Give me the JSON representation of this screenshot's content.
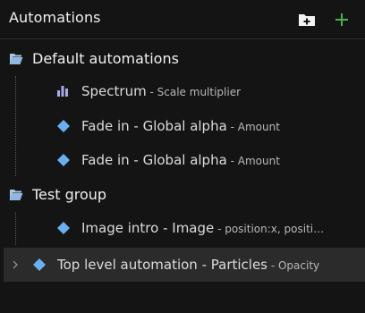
{
  "header": {
    "title": "Automations",
    "add_folder_icon": "folder-plus-icon",
    "add_icon": "plus-icon"
  },
  "groups": [
    {
      "label": "Default automations",
      "icon": "folder-open-icon",
      "items": [
        {
          "main": "Spectrum",
          "sep": " - ",
          "sub": "Scale multiplier",
          "icon": "bar-chart-icon"
        },
        {
          "main": "Fade in - Global alpha",
          "sep": " - ",
          "sub": "Amount",
          "icon": "diamond-icon"
        },
        {
          "main": "Fade in - Global alpha",
          "sep": " - ",
          "sub": "Amount",
          "icon": "diamond-icon"
        }
      ]
    },
    {
      "label": "Test group",
      "icon": "folder-open-icon",
      "items": [
        {
          "main": "Image intro - Image",
          "sep": " - ",
          "sub": "position:x, positi…",
          "icon": "diamond-icon"
        }
      ]
    }
  ],
  "top_level": {
    "main": "Top level automation - Particles",
    "sep": " - ",
    "sub": "Opacity",
    "icon": "diamond-icon",
    "chevron_icon": "chevron-right-icon"
  },
  "colors": {
    "accent_green": "#4caf50",
    "diamond_blue": "#6ab0f0",
    "folder_blue": "#8fb7e0",
    "selected_row": "#2b2b2b"
  }
}
